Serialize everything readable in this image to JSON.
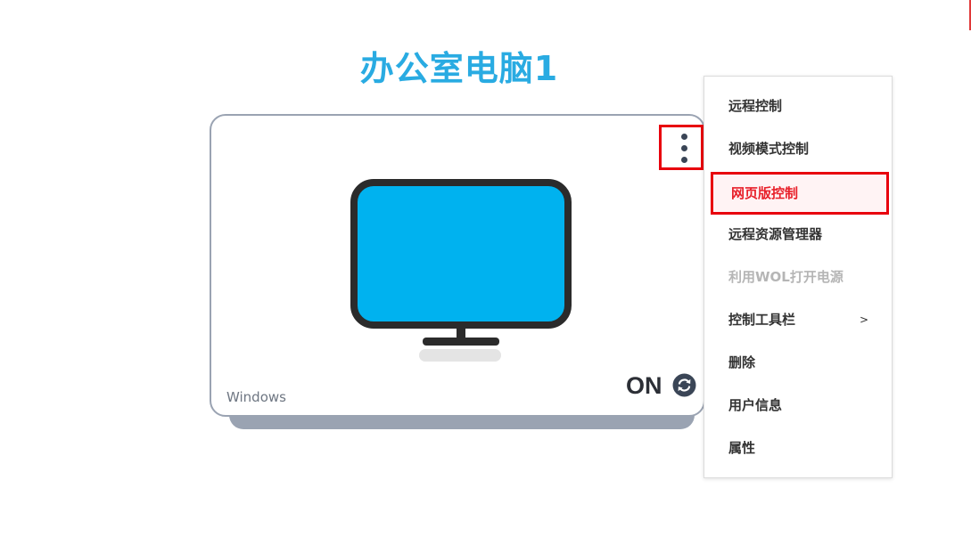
{
  "device": {
    "name": "办公室电脑1",
    "os": "Windows",
    "status": "ON"
  },
  "colors": {
    "title": "#29abe2",
    "screen": "#00b2ef",
    "bezel": "#2b2b2b",
    "highlight": "#e8000d"
  },
  "icons": {
    "more": "kebab-vertical-icon",
    "refresh": "refresh-circle-icon",
    "monitor": "monitor-icon"
  },
  "menu": {
    "items": [
      {
        "label": "远程控制"
      },
      {
        "label": "视频模式控制"
      },
      {
        "label": "网页版控制"
      },
      {
        "label": "远程资源管理器"
      },
      {
        "label": "利用WOL打开电源"
      },
      {
        "label": "控制工具栏",
        "arrow": ">"
      },
      {
        "label": "删除"
      },
      {
        "label": "用户信息"
      },
      {
        "label": "属性"
      }
    ]
  }
}
